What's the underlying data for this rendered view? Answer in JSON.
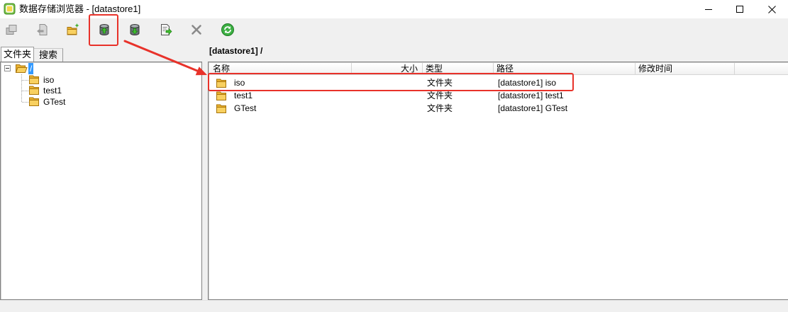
{
  "window": {
    "title": "数据存储浏览器 - [datastore1]",
    "app_icon": "vsphere-app-icon",
    "controls": [
      "minimize-icon",
      "maximize-icon",
      "close-icon"
    ]
  },
  "toolbar": {
    "buttons": [
      {
        "icon": "copy-icon",
        "enabled": false
      },
      {
        "icon": "move-icon",
        "enabled": false
      },
      {
        "icon": "new-folder-icon",
        "enabled": true
      },
      {
        "icon": "upload-icon",
        "enabled": true,
        "annotated": true
      },
      {
        "icon": "download-icon",
        "enabled": true
      },
      {
        "icon": "register-vm-icon",
        "enabled": true
      },
      {
        "icon": "delete-icon",
        "enabled": false
      },
      {
        "icon": "refresh-icon",
        "enabled": true
      }
    ]
  },
  "left_panel": {
    "tabs": [
      {
        "label": "文件夹",
        "active": true
      },
      {
        "label": "搜索",
        "active": false
      }
    ],
    "tree": {
      "root": {
        "label": "/",
        "expanded": true,
        "selected": true,
        "icon": "open-folder-icon"
      },
      "children": [
        {
          "label": "iso",
          "icon": "folder-icon"
        },
        {
          "label": "test1",
          "icon": "folder-icon"
        },
        {
          "label": "GTest",
          "icon": "folder-icon"
        }
      ]
    }
  },
  "right_panel": {
    "location": "[datastore1] /",
    "columns": [
      "名称",
      "大小",
      "类型",
      "路径",
      "修改时间"
    ],
    "rows": [
      {
        "name": "iso",
        "size": "",
        "type": "文件夹",
        "path": "[datastore1] iso",
        "modified": "",
        "annotated": true
      },
      {
        "name": "test1",
        "size": "",
        "type": "文件夹",
        "path": "[datastore1] test1",
        "modified": ""
      },
      {
        "name": "GTest",
        "size": "",
        "type": "文件夹",
        "path": "[datastore1] GTest",
        "modified": ""
      }
    ]
  },
  "colors": {
    "chrome_bg": "#f0f0f0",
    "selection_bg": "#3399ff",
    "annotation_red": "#e8322a",
    "folder_yellow": "#f8d060"
  }
}
